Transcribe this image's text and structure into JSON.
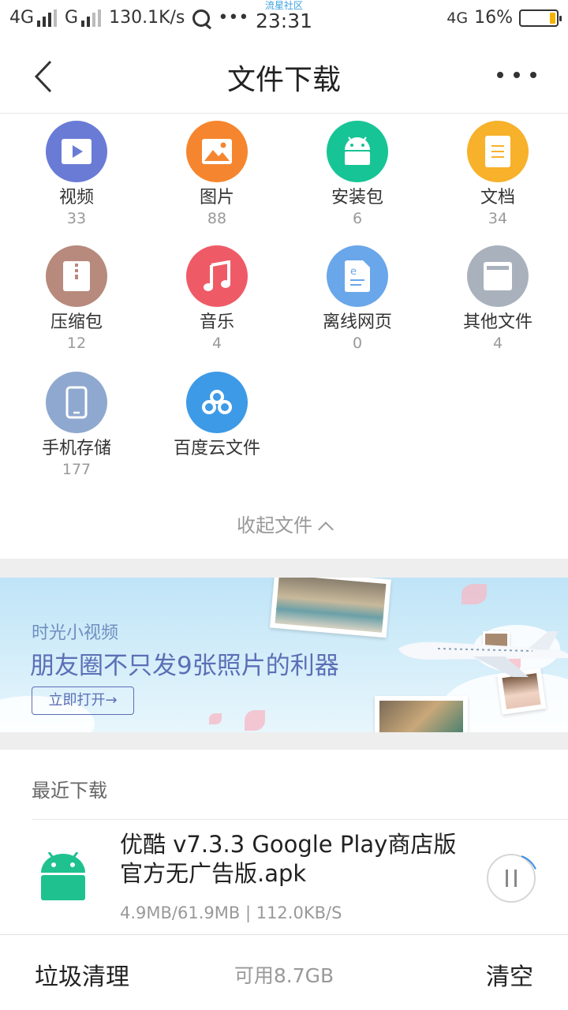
{
  "status_bar": {
    "net1": "4G",
    "net2": "G",
    "speed": "130.1K/s",
    "dots": "•••",
    "carrier": "流星社区",
    "time": "23:31",
    "net3": "4G",
    "battery": "16%",
    "battery_level": 0.16,
    "battery_color": "#f5b400"
  },
  "header": {
    "title": "文件下载",
    "back_icon": "chevron-left-icon",
    "more_icon": "more-dots-icon"
  },
  "categories": [
    {
      "name": "视频",
      "count": "33",
      "icon": "video-icon",
      "color": "#6a7bd6"
    },
    {
      "name": "图片",
      "count": "88",
      "icon": "image-icon",
      "color": "#f5862f"
    },
    {
      "name": "安装包",
      "count": "6",
      "icon": "android-icon",
      "color": "#17c495"
    },
    {
      "name": "文档",
      "count": "34",
      "icon": "document-icon",
      "color": "#f7b12a"
    },
    {
      "name": "压缩包",
      "count": "12",
      "icon": "archive-icon",
      "color": "#b78a7d"
    },
    {
      "name": "音乐",
      "count": "4",
      "icon": "music-icon",
      "color": "#ee5b67"
    },
    {
      "name": "离线网页",
      "count": "0",
      "icon": "webpage-icon",
      "color": "#6aa6ea"
    },
    {
      "name": "其他文件",
      "count": "4",
      "icon": "other-file-icon",
      "color": "#a9b1bd"
    },
    {
      "name": "手机存储",
      "count": "177",
      "icon": "phone-icon",
      "color": "#8fa8cf"
    },
    {
      "name": "百度云文件",
      "count": "",
      "icon": "cloud-icon",
      "color": "#3d9ae6"
    }
  ],
  "collapse_label": "收起文件",
  "banner": {
    "subtitle": "时光小视频",
    "headline": "朋友圈不只发9张照片的利器",
    "button": "立即打开→"
  },
  "recent": {
    "title": "最近下载",
    "items": [
      {
        "name": "优酷 v7.3.3 Google Play商店版 官方无广告版.apk",
        "meta": "4.9MB/61.9MB | 112.0KB/S",
        "icon": "android-icon",
        "icon_color": "#1fc18f",
        "action_icon": "pause-icon"
      }
    ]
  },
  "bottom_bar": {
    "left": "垃圾清理",
    "center": "可用8.7GB",
    "right": "清空"
  }
}
